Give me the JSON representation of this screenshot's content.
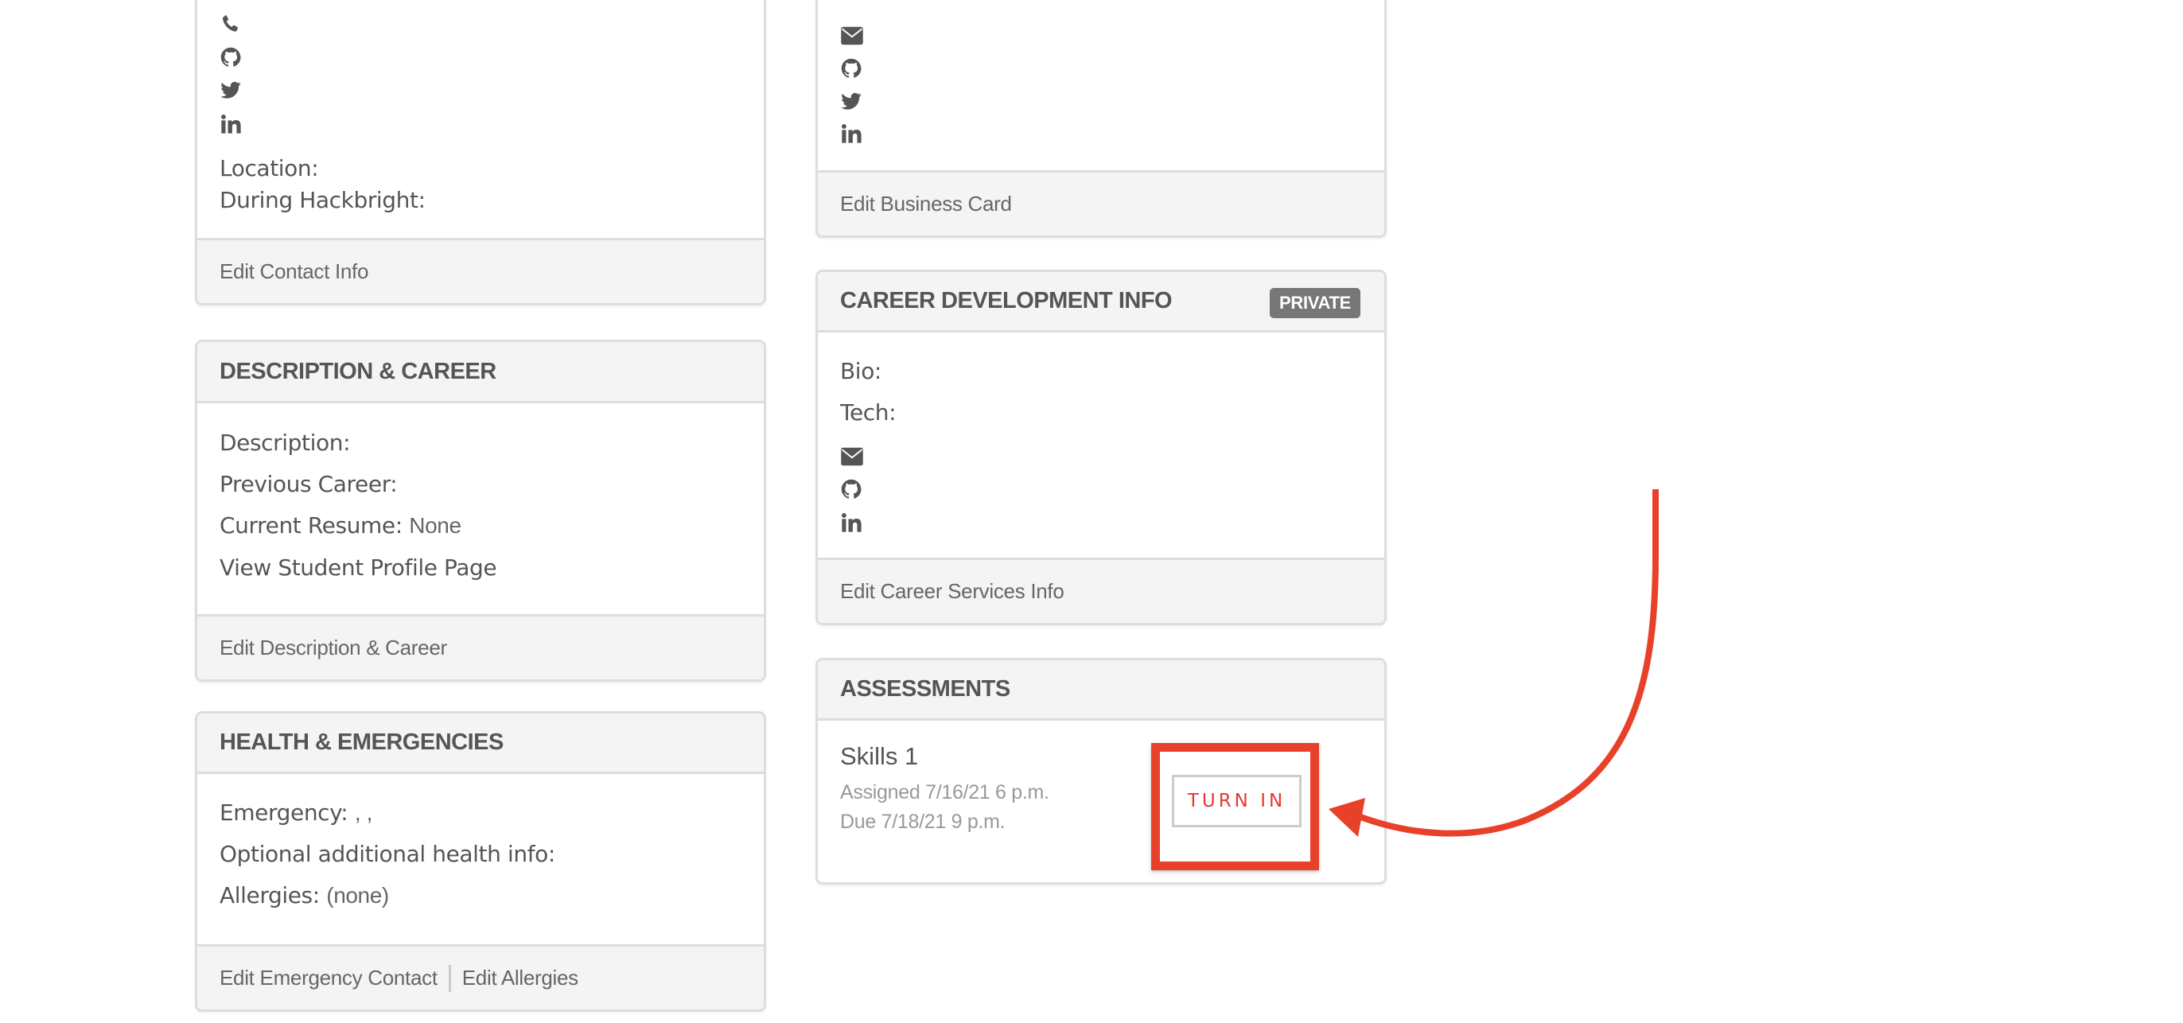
{
  "left_column": {
    "contact_card": {
      "icons": [
        "phone-icon",
        "github-icon",
        "twitter-icon",
        "linkedin-icon"
      ],
      "location_label": "Location:",
      "during_hackbright_label": "During Hackbright:",
      "footer_link": "Edit Contact Info"
    },
    "description_card": {
      "title": "DESCRIPTION & CAREER",
      "description_label": "Description:",
      "previous_career_label": "Previous Career:",
      "current_resume_label": "Current Resume:",
      "current_resume_value": "None",
      "profile_link": "View Student Profile Page",
      "footer_link": "Edit Description & Career"
    },
    "health_card": {
      "title": "HEALTH & EMERGENCIES",
      "emergency_label": "Emergency:",
      "emergency_value": ", ,",
      "health_info_label": "Optional additional health info:",
      "allergies_label": "Allergies:",
      "allergies_value": "(none)",
      "footer_links": [
        "Edit Emergency Contact",
        "Edit Allergies"
      ]
    }
  },
  "right_column": {
    "business_card": {
      "icons": [
        "envelope-icon",
        "github-icon",
        "twitter-icon",
        "linkedin-icon"
      ],
      "footer_link": "Edit Business Card"
    },
    "career_card": {
      "title": "CAREER DEVELOPMENT INFO",
      "badge": "PRIVATE",
      "bio_label": "Bio:",
      "tech_label": "Tech:",
      "icons": [
        "envelope-icon",
        "github-icon",
        "linkedin-icon"
      ],
      "footer_link": "Edit Career Services Info"
    },
    "assessments_card": {
      "title": "ASSESSMENTS",
      "items": [
        {
          "name": "Skills 1",
          "assigned": "Assigned 7/16/21 6 p.m.",
          "due": "Due 7/18/21 9 p.m.",
          "action": "TURN IN"
        }
      ]
    }
  },
  "annotation": {
    "color": "#e8412a",
    "target": "turn-in-button"
  }
}
